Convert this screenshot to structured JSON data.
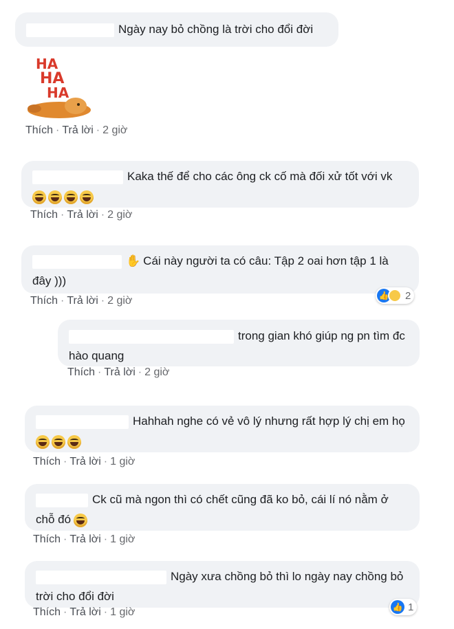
{
  "actions": {
    "like": "Thích",
    "reply": "Trả lời",
    "sep": "·"
  },
  "comments": [
    {
      "text": "Ngày nay bỏ chồng là trời cho đổi đời",
      "time": "2 giờ",
      "sticker": "haha-sticker",
      "sticker_letters": [
        "HA",
        "HA",
        "HA"
      ]
    },
    {
      "text": "Kaka thế để cho các ông ck cố mà đối xử tốt với vk",
      "emoji": "laughing-emoji",
      "emoji_count": 4,
      "time": "2 giờ"
    },
    {
      "text": "Cái này người ta có câu: Tập 2 oai hơn tập 1 là đây )))",
      "icon": "waving-hand-icon",
      "time": "2 giờ",
      "reaction_count": "2",
      "reactions": [
        "like",
        "haha"
      ]
    },
    {
      "text": "trong gian khó giúp ng pn tìm đc hào quang",
      "time": "2 giờ",
      "is_reply": true
    },
    {
      "text": "Hahhah nghe có vẻ vô lý nhưng rất hợp lý chị em họ",
      "emoji": "rolling-laughing-emoji",
      "emoji_count": 3,
      "time": "1 giờ"
    },
    {
      "text": "Ck cũ mà ngon thì có chết cũng đã ko bỏ, cái lí nó nằm ở chỗ đó",
      "emoji": "grinning-sweat-emoji",
      "emoji_count": 1,
      "time": "1 giờ"
    },
    {
      "text": "Ngày xưa chồng bỏ thì lo ngày nay chồng bỏ trời cho đổi đời",
      "time": "1 giờ",
      "reaction_count": "1",
      "reactions": [
        "like"
      ]
    }
  ]
}
